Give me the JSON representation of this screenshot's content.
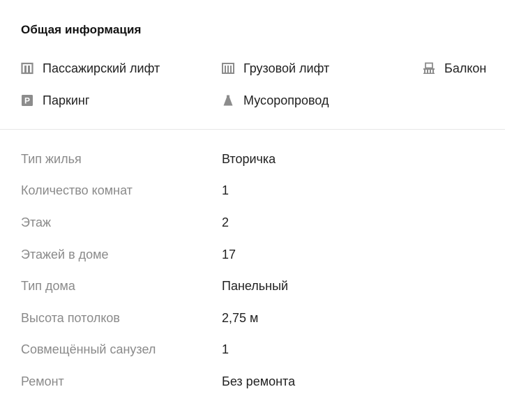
{
  "general": {
    "title": "Общая информация",
    "features": [
      {
        "icon": "passenger-elevator-icon",
        "label": "Пассажирский лифт"
      },
      {
        "icon": "freight-elevator-icon",
        "label": "Грузовой лифт"
      },
      {
        "icon": "balcony-icon",
        "label": "Балкон"
      },
      {
        "icon": "parking-icon",
        "label": "Паркинг"
      },
      {
        "icon": "garbage-chute-icon",
        "label": "Мусоропровод"
      }
    ]
  },
  "params": [
    {
      "name": "Тип жилья",
      "value": "Вторичка"
    },
    {
      "name": "Количество комнат",
      "value": "1"
    },
    {
      "name": "Этаж",
      "value": "2"
    },
    {
      "name": "Этажей в доме",
      "value": "17"
    },
    {
      "name": "Тип дома",
      "value": "Панельный"
    },
    {
      "name": "Высота потолков",
      "value": "2,75 м"
    },
    {
      "name": "Совмещённый санузел",
      "value": "1"
    },
    {
      "name": "Ремонт",
      "value": "Без ремонта"
    }
  ],
  "colors": {
    "icon": "#8c8c8c",
    "label_muted": "#8a8a8a",
    "text": "#222222",
    "divider": "#e6e6e6"
  }
}
